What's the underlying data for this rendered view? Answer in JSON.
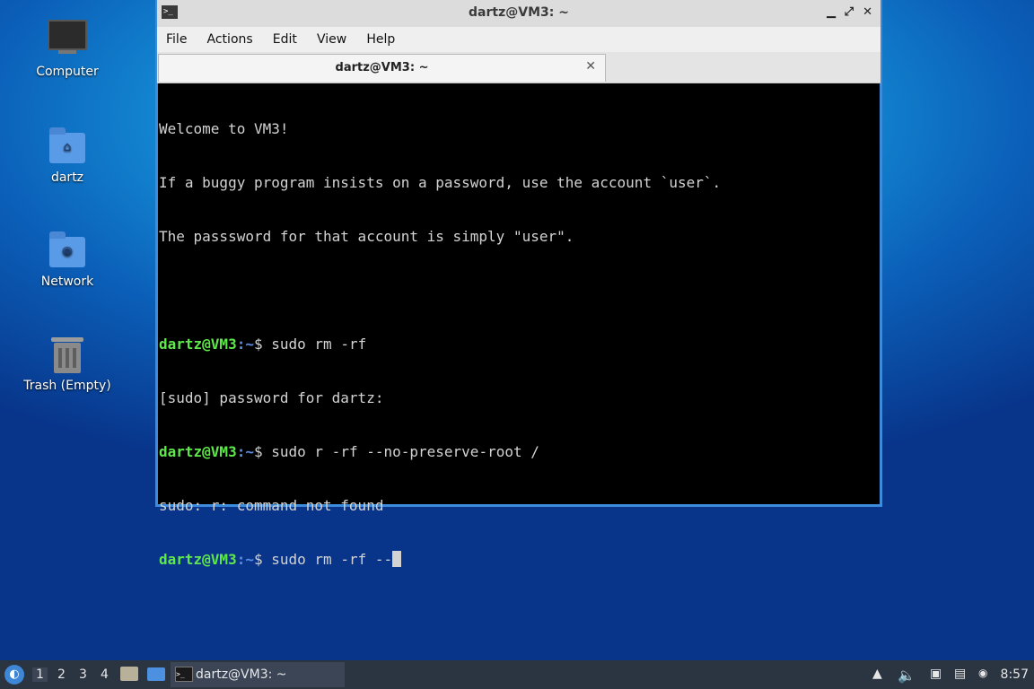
{
  "desktop": {
    "icons": [
      {
        "label": "Computer"
      },
      {
        "label": "dartz"
      },
      {
        "label": "Network"
      },
      {
        "label": "Trash (Empty)"
      }
    ]
  },
  "window": {
    "title": "dartz@VM3: ~",
    "menu": [
      "File",
      "Actions",
      "Edit",
      "View",
      "Help"
    ],
    "tab_label": "dartz@VM3: ~",
    "terminal": {
      "lines": [
        "Welcome to VM3!",
        "If a buggy program insists on a password, use the account `user`.",
        "The passsword for that account is simply \"user\".",
        ""
      ],
      "prompt_user": "dartz@VM3",
      "prompt_sep": ":",
      "prompt_path": "~",
      "prompt_dollar": "$ ",
      "cmd1": "sudo rm -rf",
      "out1": "[sudo] password for dartz:",
      "cmd2": "sudo r -rf --no-preserve-root /",
      "out2": "sudo: r: command not found",
      "cmd3": "sudo rm -rf --"
    }
  },
  "taskbar": {
    "workspaces": [
      "1",
      "2",
      "3",
      "4"
    ],
    "active_workspace": "1",
    "task_label": "dartz@VM3: ~",
    "clock": "8:57"
  }
}
